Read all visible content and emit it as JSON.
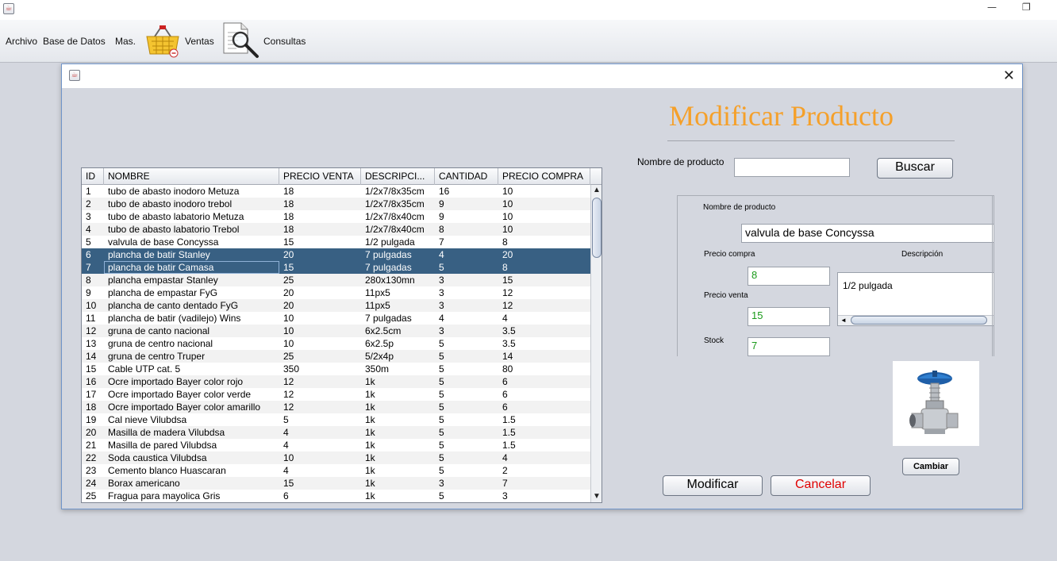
{
  "window": {
    "minimize": "—",
    "maximize": "❐"
  },
  "menubar": {
    "archivo": "Archivo",
    "base_datos": "Base de Datos",
    "mas": "Mas.",
    "ventas": "Ventas",
    "consultas": "Consultas"
  },
  "dialog": {
    "close": "✕",
    "heading": "Modificar Producto",
    "search_label": "Nombre de producto",
    "search_value": "",
    "search_button": "Buscar",
    "form": {
      "name_label": "Nombre de producto",
      "name_value": "valvula de base Concyssa",
      "precio_compra_label": "Precio compra",
      "precio_compra_value": "8",
      "precio_venta_label": "Precio venta",
      "precio_venta_value": "15",
      "stock_label": "Stock",
      "stock_value": "7",
      "descripcion_label": "Descripción",
      "descripcion_value": "1/2 pulgada"
    },
    "cambiar_button": "Cambiar",
    "modificar_button": "Modificar",
    "cancelar_button": "Cancelar",
    "cancelar_color": "#e00000",
    "heading_color": "#f5a02a",
    "selection_color": "#386083"
  },
  "table": {
    "columns": [
      "ID",
      "NOMBRE",
      "PRECIO VENTA",
      "DESCRIPCI...",
      "CANTIDAD",
      "PRECIO COMPRA"
    ],
    "selected_ids": [
      "6",
      "7"
    ],
    "rows": [
      [
        "1",
        "tubo de abasto inodoro Metuza",
        "18",
        "1/2x7/8x35cm",
        "16",
        "10"
      ],
      [
        "2",
        "tubo de abasto inodoro trebol",
        "18",
        "1/2x7/8x35cm",
        "9",
        "10"
      ],
      [
        "3",
        "tubo de abasto labatorio Metuza",
        "18",
        "1/2x7/8x40cm",
        "9",
        "10"
      ],
      [
        "4",
        "tubo de abasto labatorio Trebol",
        "18",
        "1/2x7/8x40cm",
        "8",
        "10"
      ],
      [
        "5",
        "valvula de base Concyssa",
        "15",
        "1/2 pulgada",
        "7",
        "8"
      ],
      [
        "6",
        "plancha de batir Stanley",
        "20",
        "7 pulgadas",
        "4",
        "20"
      ],
      [
        "7",
        "plancha de batir Camasa",
        "15",
        "7 pulgadas",
        "5",
        "8"
      ],
      [
        "8",
        "plancha empastar Stanley",
        "25",
        "280x130mn",
        "3",
        "15"
      ],
      [
        "9",
        "plancha de empastar FyG",
        "20",
        "11px5",
        "3",
        "12"
      ],
      [
        "10",
        "plancha de canto dentado FyG",
        "20",
        "11px5",
        "3",
        "12"
      ],
      [
        "11",
        "plancha de batir (vadilejo) Wins",
        "10",
        "7 pulgadas",
        "4",
        "4"
      ],
      [
        "12",
        "gruna de canto nacional",
        "10",
        "6x2.5cm",
        "3",
        "3.5"
      ],
      [
        "13",
        "gruna de centro nacional",
        "10",
        "6x2.5p",
        "5",
        "3.5"
      ],
      [
        "14",
        "gruna de centro Truper",
        "25",
        "5/2x4p",
        "5",
        "14"
      ],
      [
        "15",
        "Cable UTP cat. 5",
        "350",
        "350m",
        "5",
        "80"
      ],
      [
        "16",
        "Ocre importado Bayer color rojo",
        "12",
        "1k",
        "5",
        "6"
      ],
      [
        "17",
        "Ocre importado Bayer color verde",
        "12",
        "1k",
        "5",
        "6"
      ],
      [
        "18",
        "Ocre importado Bayer color amarillo",
        "12",
        "1k",
        "5",
        "6"
      ],
      [
        "19",
        "Cal nieve Vilubdsa",
        "5",
        "1k",
        "5",
        "1.5"
      ],
      [
        "20",
        "Masilla de madera Vilubdsa",
        "4",
        "1k",
        "5",
        "1.5"
      ],
      [
        "21",
        "Masilla de pared Vilubdsa",
        "4",
        "1k",
        "5",
        "1.5"
      ],
      [
        "22",
        "Soda caustica Vilubdsa",
        "10",
        "1k",
        "5",
        "4"
      ],
      [
        "23",
        "Cemento blanco Huascaran",
        "4",
        "1k",
        "5",
        "2"
      ],
      [
        "24",
        "Borax americano",
        "15",
        "1k",
        "3",
        "7"
      ],
      [
        "25",
        "Fragua para mayolica Gris",
        "6",
        "1k",
        "5",
        "3"
      ]
    ]
  },
  "icons": {
    "app": "java-cup-icon",
    "ventas": "shopping-basket-icon",
    "consultas": "document-magnifier-icon",
    "product": "valve-product-image"
  }
}
